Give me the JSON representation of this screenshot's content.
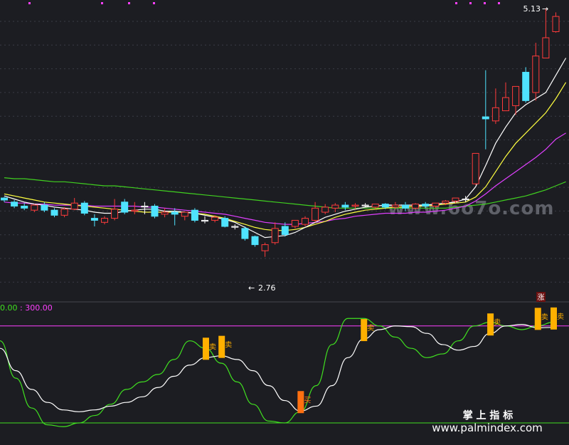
{
  "chart_data": [
    {
      "type": "candlestick",
      "panel": "price",
      "price_range": [
        2.4,
        5.25
      ],
      "high_label": "5.13",
      "low_label": "2.76",
      "low_arrow": "←",
      "high_arrow": "→",
      "badge": "涨",
      "watermark": "www.6o7o.com",
      "colors": {
        "up": "#ff3b3b",
        "down": "#4fe3ff",
        "ma1": "#ffffff",
        "ma2": "#ffff40",
        "ma3": "#e040ff",
        "ma4": "#40d020",
        "flat": "#ffffff"
      },
      "candles": [
        [
          3.34,
          3.35,
          3.32,
          3.3
        ],
        [
          3.3,
          3.32,
          3.26,
          3.24
        ],
        [
          3.26,
          3.29,
          3.24,
          3.22
        ],
        [
          3.22,
          3.28,
          3.27,
          3.2
        ],
        [
          3.27,
          3.3,
          3.22,
          3.2
        ],
        [
          3.22,
          3.24,
          3.17,
          3.15
        ],
        [
          3.17,
          3.25,
          3.23,
          3.15
        ],
        [
          3.23,
          3.34,
          3.29,
          3.22
        ],
        [
          3.29,
          3.31,
          3.19,
          3.17
        ],
        [
          3.14,
          3.18,
          3.12,
          3.06
        ],
        [
          3.1,
          3.16,
          3.14,
          3.08
        ],
        [
          3.14,
          3.33,
          3.23,
          3.12
        ],
        [
          3.3,
          3.33,
          3.2,
          3.18
        ],
        [
          3.21,
          3.3,
          3.22,
          3.18
        ],
        [
          3.26,
          3.3,
          3.26,
          3.18
        ],
        [
          3.26,
          3.28,
          3.16,
          3.14
        ],
        [
          3.18,
          3.24,
          3.2,
          3.15
        ],
        [
          3.2,
          3.24,
          3.18,
          3.07
        ],
        [
          3.16,
          3.2,
          3.2,
          3.12
        ],
        [
          3.22,
          3.24,
          3.12,
          3.1
        ],
        [
          3.12,
          3.16,
          3.12,
          3.09
        ],
        [
          3.12,
          3.17,
          3.15,
          3.1
        ],
        [
          3.14,
          3.16,
          3.06,
          3.05
        ],
        [
          3.06,
          3.08,
          3.06,
          3.03
        ],
        [
          3.04,
          3.06,
          2.94,
          2.92
        ],
        [
          2.96,
          2.97,
          2.88,
          2.86
        ],
        [
          2.82,
          2.9,
          2.88,
          2.76
        ],
        [
          2.9,
          3.1,
          3.04,
          2.88
        ],
        [
          3.06,
          3.1,
          2.98,
          2.96
        ],
        [
          3.06,
          3.12,
          3.12,
          3.04
        ],
        [
          3.08,
          3.16,
          3.14,
          3.06
        ],
        [
          3.12,
          3.3,
          3.24,
          3.1
        ],
        [
          3.2,
          3.28,
          3.25,
          3.18
        ],
        [
          3.24,
          3.29,
          3.27,
          3.2
        ],
        [
          3.27,
          3.3,
          3.25,
          3.22
        ],
        [
          3.26,
          3.29,
          3.27,
          3.23
        ],
        [
          3.27,
          3.29,
          3.27,
          3.25
        ],
        [
          3.25,
          3.28,
          3.28,
          3.23
        ],
        [
          3.28,
          3.29,
          3.25,
          3.23
        ],
        [
          3.25,
          3.3,
          3.27,
          3.23
        ],
        [
          3.27,
          3.3,
          3.24,
          3.21
        ],
        [
          3.24,
          3.29,
          3.28,
          3.23
        ],
        [
          3.28,
          3.3,
          3.26,
          3.24
        ],
        [
          3.26,
          3.29,
          3.29,
          3.24
        ],
        [
          3.29,
          3.32,
          3.31,
          3.27
        ],
        [
          3.31,
          3.34,
          3.34,
          3.29
        ],
        [
          3.33,
          3.36,
          3.33,
          3.3
        ],
        [
          3.48,
          3.78,
          3.78,
          3.47
        ],
        [
          4.14,
          4.6,
          4.12,
          3.82
        ],
        [
          4.1,
          4.42,
          4.23,
          4.07
        ],
        [
          4.2,
          4.48,
          4.33,
          4.23
        ],
        [
          4.25,
          4.35,
          4.44,
          4.16
        ],
        [
          4.58,
          4.63,
          4.3,
          4.28
        ],
        [
          4.38,
          4.87,
          4.74,
          4.3
        ],
        [
          4.72,
          5.21,
          4.92,
          4.72
        ],
        [
          4.98,
          5.17,
          5.13,
          4.97
        ]
      ],
      "ma1": [
        3.36,
        3.33,
        3.3,
        3.28,
        3.27,
        3.25,
        3.24,
        3.23,
        3.22,
        3.2,
        3.19,
        3.19,
        3.21,
        3.22,
        3.23,
        3.23,
        3.21,
        3.21,
        3.2,
        3.19,
        3.17,
        3.15,
        3.13,
        3.1,
        3.05,
        3.0,
        2.95,
        2.96,
        2.97,
        3.0,
        3.05,
        3.1,
        3.15,
        3.18,
        3.21,
        3.23,
        3.25,
        3.26,
        3.27,
        3.27,
        3.27,
        3.27,
        3.27,
        3.28,
        3.29,
        3.3,
        3.33,
        3.45,
        3.66,
        3.88,
        4.04,
        4.18,
        4.26,
        4.32,
        4.38,
        4.55,
        4.72
      ],
      "ma2": [
        3.38,
        3.36,
        3.34,
        3.32,
        3.3,
        3.29,
        3.28,
        3.27,
        3.26,
        3.25,
        3.24,
        3.23,
        3.22,
        3.21,
        3.2,
        3.2,
        3.2,
        3.2,
        3.2,
        3.19,
        3.18,
        3.16,
        3.14,
        3.11,
        3.08,
        3.05,
        3.03,
        3.02,
        3.02,
        3.03,
        3.05,
        3.08,
        3.11,
        3.15,
        3.18,
        3.2,
        3.22,
        3.23,
        3.24,
        3.25,
        3.25,
        3.26,
        3.26,
        3.27,
        3.28,
        3.29,
        3.3,
        3.35,
        3.45,
        3.6,
        3.75,
        3.88,
        3.98,
        4.08,
        4.18,
        4.32,
        4.48
      ],
      "ma3": [
        3.3,
        3.29,
        3.29,
        3.28,
        3.28,
        3.27,
        3.27,
        3.27,
        3.27,
        3.26,
        3.26,
        3.26,
        3.26,
        3.26,
        3.25,
        3.25,
        3.24,
        3.23,
        3.22,
        3.21,
        3.2,
        3.19,
        3.18,
        3.16,
        3.14,
        3.12,
        3.1,
        3.09,
        3.08,
        3.08,
        3.09,
        3.1,
        3.11,
        3.13,
        3.14,
        3.16,
        3.17,
        3.18,
        3.19,
        3.19,
        3.19,
        3.2,
        3.2,
        3.21,
        3.22,
        3.24,
        3.26,
        3.31,
        3.38,
        3.46,
        3.53,
        3.6,
        3.67,
        3.74,
        3.82,
        3.92,
        3.98
      ],
      "ma4": [
        3.54,
        3.53,
        3.53,
        3.52,
        3.51,
        3.5,
        3.5,
        3.49,
        3.48,
        3.47,
        3.46,
        3.46,
        3.45,
        3.44,
        3.43,
        3.42,
        3.41,
        3.4,
        3.39,
        3.38,
        3.37,
        3.36,
        3.35,
        3.34,
        3.33,
        3.32,
        3.31,
        3.3,
        3.29,
        3.28,
        3.27,
        3.26,
        3.25,
        3.24,
        3.24,
        3.24,
        3.24,
        3.24,
        3.24,
        3.24,
        3.24,
        3.24,
        3.24,
        3.24,
        3.24,
        3.25,
        3.26,
        3.27,
        3.28,
        3.3,
        3.32,
        3.34,
        3.36,
        3.39,
        3.42,
        3.46,
        3.5
      ]
    },
    {
      "type": "line",
      "panel": "indicator",
      "header": "0.00 : 300.00",
      "header_part1": "0.00",
      "header_sep": " : ",
      "header_part2": "300.00",
      "range": [
        0,
        330
      ],
      "upper_ref": 300,
      "lower_ref": 40,
      "footer_label": "掌 上 指 标",
      "footer_url": "www.palmindex.com",
      "colors": {
        "white": "#ffffff",
        "green": "#40e020",
        "upper_ref": "#ff40ff",
        "lower_ref": "#40e020",
        "sell": "#ffb000",
        "buy": "#ff7010"
      },
      "white_line": [
        240,
        180,
        130,
        95,
        75,
        70,
        75,
        85,
        95,
        110,
        135,
        165,
        195,
        215,
        220,
        210,
        180,
        140,
        100,
        72,
        85,
        140,
        215,
        265,
        290,
        300,
        298,
        280,
        250,
        235,
        245,
        280,
        300,
        304,
        295,
        296
      ],
      "green_line": [
        260,
        160,
        80,
        35,
        30,
        40,
        60,
        90,
        130,
        150,
        170,
        210,
        260,
        240,
        200,
        150,
        90,
        45,
        40,
        70,
        140,
        250,
        320,
        320,
        300,
        270,
        240,
        215,
        225,
        260,
        300,
        310,
        300,
        290,
        300,
        310
      ],
      "signals": [
        {
          "x": 13,
          "type": "sell",
          "label": "卖"
        },
        {
          "x": 14,
          "type": "sell",
          "label": "卖"
        },
        {
          "x": 19,
          "type": "buy",
          "label": "买"
        },
        {
          "x": 23,
          "type": "sell",
          "label": "卖"
        },
        {
          "x": 31,
          "type": "sell",
          "label": "卖"
        },
        {
          "x": 34,
          "type": "sell",
          "label": "卖"
        },
        {
          "x": 35,
          "type": "sell",
          "label": "卖"
        }
      ]
    }
  ]
}
